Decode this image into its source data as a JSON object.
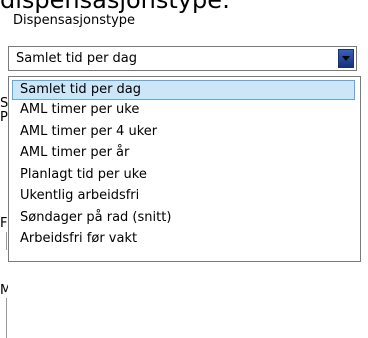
{
  "heading": "dispensasjonstype:",
  "field": {
    "label": "Dispensasjonstype",
    "selected_value": "Samlet tid per dag"
  },
  "background_fragments": {
    "a": "S",
    "b": "P",
    "c": "F",
    "d": "M"
  },
  "dropdown": {
    "options": [
      {
        "label": "Samlet tid per dag",
        "selected": true
      },
      {
        "label": "AML timer per uke",
        "selected": false
      },
      {
        "label": "AML timer per 4 uker",
        "selected": false
      },
      {
        "label": "AML timer per år",
        "selected": false
      },
      {
        "label": "Planlagt tid per uke",
        "selected": false
      },
      {
        "label": "Ukentlig arbeidsfri",
        "selected": false
      },
      {
        "label": "Søndager på rad (snitt)",
        "selected": false
      },
      {
        "label": "Arbeidsfri før vakt",
        "selected": false
      }
    ]
  },
  "icons": {
    "dropdown_arrow": "chevron-down-icon"
  },
  "colors": {
    "selection_fill": "#cde6f7",
    "selection_border": "#5aa9e0",
    "arrow_button": "#1f3a8a"
  }
}
